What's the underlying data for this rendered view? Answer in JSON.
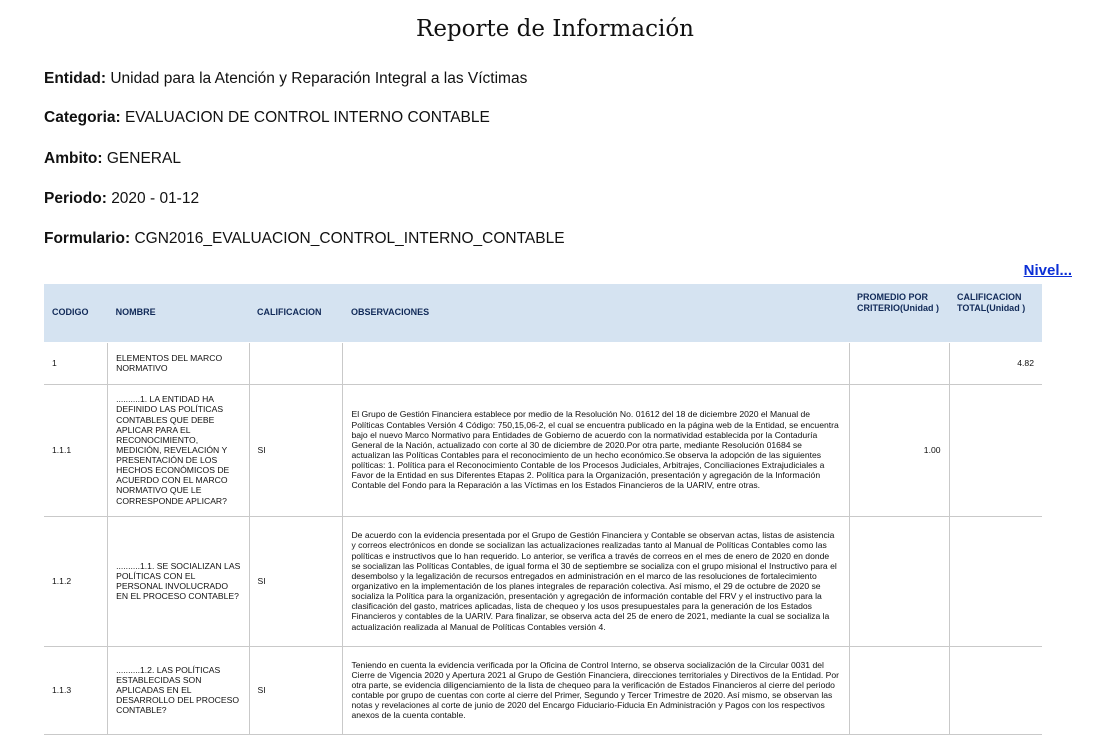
{
  "title": "Reporte de Información",
  "meta": {
    "entidad_label": "Entidad:",
    "entidad_value": "Unidad para la Atención y Reparación Integral a las Víctimas",
    "categoria_label": "Categoria:",
    "categoria_value": "EVALUACION DE CONTROL INTERNO CONTABLE",
    "ambito_label": "Ambito:",
    "ambito_value": "GENERAL",
    "periodo_label": "Periodo:",
    "periodo_value": "2020 - 01-12",
    "formulario_label": "Formulario:",
    "formulario_value": "CGN2016_EVALUACION_CONTROL_INTERNO_CONTABLE"
  },
  "nivel_link": "Nivel...",
  "table": {
    "headers": {
      "codigo": "CODIGO",
      "nombre": "NOMBRE",
      "calificacion": "CALIFICACION",
      "observaciones": "OBSERVACIONES",
      "promedio": "PROMEDIO POR CRITERIO(Unidad )",
      "total": "CALIFICACION TOTAL(Unidad )"
    },
    "rows": [
      {
        "codigo": "1",
        "nombre": "ELEMENTOS DEL MARCO NORMATIVO",
        "calificacion": "",
        "observaciones": "",
        "promedio": "",
        "total": "4.82"
      },
      {
        "codigo": "1.1.1",
        "nombre": "..........1. LA ENTIDAD HA DEFINIDO LAS POLÍTICAS CONTABLES QUE DEBE APLICAR PARA EL RECONOCIMIENTO, MEDICIÓN, REVELACIÓN Y PRESENTACIÓN DE LOS HECHOS ECONÓMICOS DE ACUERDO CON EL MARCO NORMATIVO QUE LE CORRESPONDE APLICAR?",
        "calificacion": "SI",
        "observaciones": "El Grupo de Gestión Financiera establece por medio de la Resolución No. 01612 del 18 de diciembre 2020 el Manual de Políticas Contables Versión 4 Código: 750,15,06-2, el cual se encuentra publicado en la página web de la Entidad, se encuentra bajo el nuevo Marco Normativo para Entidades de Gobierno de acuerdo con la normatividad establecida por la Contaduría General de la Nación, actualizado con corte al 30 de diciembre de 2020.Por otra parte, mediante Resolución 01684 se actualizan las Políticas Contables para el reconocimiento de un hecho económico.Se observa la adopción de las siguientes políticas: 1. Política para el Reconocimiento Contable de los Procesos Judiciales, Arbitrajes, Conciliaciones Extrajudiciales a Favor de la Entidad en sus Diferentes Etapas 2. Política para la Organización, presentación y agregación de la Información Contable del Fondo para la Reparación a las Víctimas en los Estados Financieros de la UARIV, entre otras.",
        "promedio": "1.00",
        "total": ""
      },
      {
        "codigo": "1.1.2",
        "nombre": "..........1.1. SE SOCIALIZAN LAS POLÍTICAS CON EL PERSONAL INVOLUCRADO EN EL PROCESO CONTABLE?",
        "calificacion": "SI",
        "observaciones": "De acuerdo con la evidencia presentada por el Grupo de Gestión Financiera y Contable se observan actas, listas de asistencia y correos electrónicos en donde se socializan las actualizaciones realizadas tanto al Manual de Políticas Contables como las políticas e instructivos que lo han requerido. Lo anterior, se verifica a través de correos en el mes de enero de 2020 en donde se socializan las Políticas Contables, de igual forma el 30 de septiembre se socializa con el grupo misional el Instructivo para el desembolso y la legalización de recursos entregados en administración en el marco de las resoluciones de fortalecimiento organizativo en la implementación de los planes integrales de reparación colectiva. Así mismo, el 29 de octubre de 2020 se socializa la Política para la organización, presentación y agregación de información contable del FRV y el instructivo para la clasificación del gasto, matrices aplicadas, lista de chequeo y los usos presupuestales para la generación de los Estados Financieros y contables de la UARIV. Para finalizar, se observa acta del 25 de enero de 2021, mediante la cual se socializa la actualización realizada al Manual de Políticas Contables versión 4.",
        "promedio": "",
        "total": ""
      },
      {
        "codigo": "1.1.3",
        "nombre": "..........1.2. LAS POLÍTICAS ESTABLECIDAS SON APLICADAS EN EL DESARROLLO DEL PROCESO CONTABLE?",
        "calificacion": "SI",
        "observaciones": "Teniendo en cuenta la evidencia verificada por la Oficina de Control Interno, se observa socialización de la Circular 0031 del Cierre de Vigencia 2020 y Apertura 2021 al Grupo de Gestión Financiera, direcciones territoriales y Directivos de la Entidad. Por otra parte, se evidencia diligenciamiento de la lista de chequeo para la verificación de Estados Financieros al cierre del periodo contable por grupo de cuentas con corte al cierre del Primer, Segundo y Tercer Trimestre de 2020. Así mismo, se observan las notas y revelaciones al corte de junio de 2020 del Encargo Fiduciario-Fiducia En Administración y Pagos con los respectivos anexos de la cuenta contable.",
        "promedio": "",
        "total": ""
      }
    ]
  }
}
